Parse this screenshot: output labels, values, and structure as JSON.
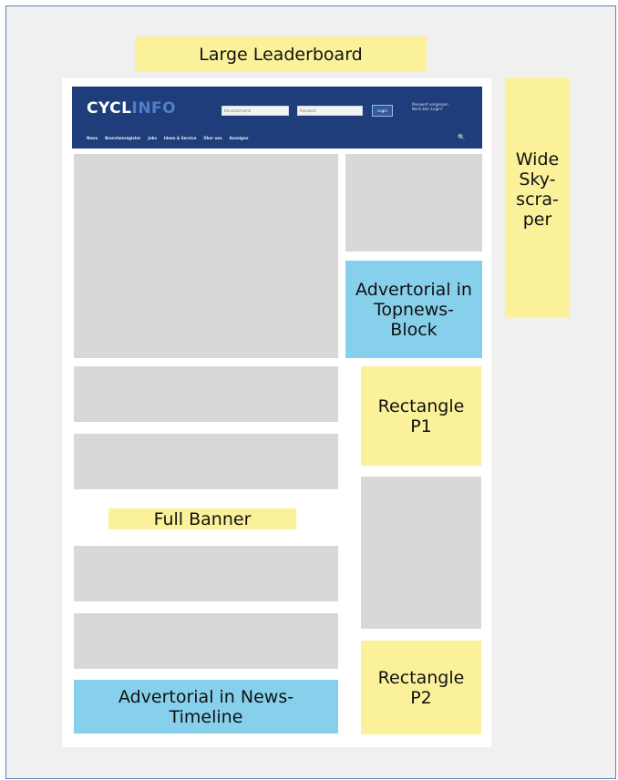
{
  "ad_slots": {
    "large_leaderboard": "Large Leaderboard",
    "wide_skyscraper": [
      "Wide",
      "Sky-",
      "scra-",
      "per"
    ],
    "advertorial_topnews": [
      "Advertorial in",
      "Topnews-",
      "Block"
    ],
    "rectangle_p1": [
      "Rectangle",
      "P1"
    ],
    "full_banner": "Full Banner",
    "rectangle_p2": [
      "Rectangle",
      "P2"
    ],
    "advertorial_timeline": [
      "Advertorial in News-",
      "Timeline"
    ]
  },
  "site_header": {
    "logo_part1": "CYCL",
    "logo_part2": "INFO",
    "username_placeholder": "Benutzername",
    "password_placeholder": "Passwort",
    "login_label": "Login",
    "links": [
      "Passwort vergessen",
      "Noch kein Login?"
    ],
    "nav_items": [
      "News",
      "Branchenregister",
      "Jobs",
      "Ideen & Service",
      "Über uns",
      "Anzeigen"
    ],
    "search_glyph": "🔍"
  },
  "colors": {
    "ad_yellow": "#fbf19a",
    "advertorial_blue": "#87d0ec",
    "content_gray": "#d8d8d8",
    "header_navy": "#1f3d7a",
    "frame_border": "#5c86b6"
  }
}
